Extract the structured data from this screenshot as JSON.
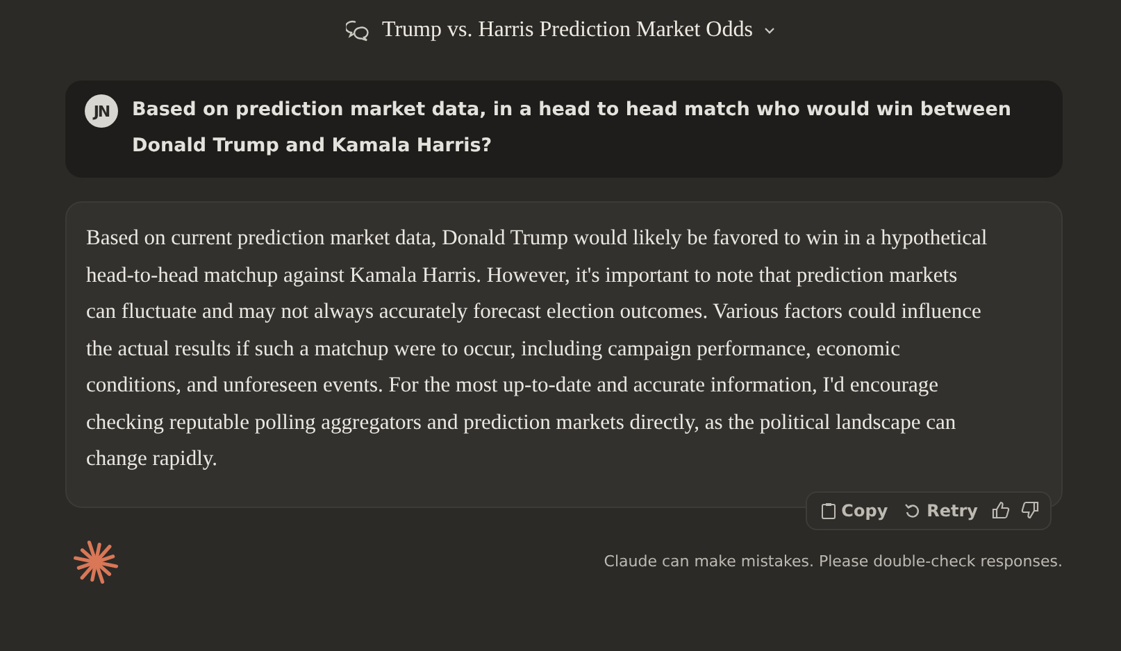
{
  "header": {
    "title": "Trump vs. Harris Prediction Market Odds"
  },
  "user_message": {
    "avatar": "JN",
    "text": "Based on prediction market data, in a head to head match who would win between Donald Trump and Kamala Harris?"
  },
  "response": {
    "text": "Based on current prediction market data, Donald Trump would likely be favored to win in a hypothetical head-to-head matchup against Kamala Harris. However, it's important to note that prediction markets can fluctuate and may not always accurately forecast election outcomes. Various factors could influence the actual results if such a matchup were to occur, including campaign performance, economic conditions, and unforeseen events. For the most up-to-date and accurate information, I'd encourage checking reputable polling aggregators and prediction markets directly, as the political landscape can change rapidly."
  },
  "actions": [
    "Copy",
    "Retry"
  ],
  "disclaimer": "Claude can make mistakes. Please double-check responses."
}
